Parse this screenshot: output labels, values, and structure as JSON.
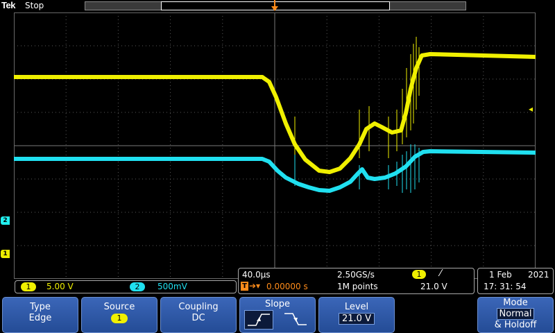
{
  "header": {
    "brand": "Tek",
    "run_state": "Stop"
  },
  "channels": [
    {
      "id": "1",
      "scale": "5.00 V",
      "color": "#f0f000"
    },
    {
      "id": "2",
      "scale": "500mV",
      "color": "#20e0f0"
    }
  ],
  "timebase": {
    "horizontal_scale": "40.0µs",
    "sample_rate": "2.50GS/s",
    "trigger_delay": "0.00000 s",
    "record_length": "1M points",
    "trigger_source": "1",
    "trigger_level": "21.0 V"
  },
  "datetime": {
    "date": "1 Feb",
    "year": "2021",
    "time": "17: 31: 54"
  },
  "menu": {
    "type": {
      "label": "Type",
      "value": "Edge"
    },
    "source": {
      "label": "Source",
      "value": "1"
    },
    "coupling": {
      "label": "Coupling",
      "value": "DC"
    },
    "slope": {
      "label": "Slope"
    },
    "level": {
      "label": "Level",
      "value": "21.0 V"
    },
    "mode": {
      "label": "Mode",
      "value": "Normal",
      "value2": "& Holdoff"
    }
  },
  "markers": {
    "trigger": "T",
    "ch1": "1",
    "ch2": "2"
  },
  "colors": {
    "ch1": "#f0f000",
    "ch2": "#20e0f0",
    "trigger": "#ff8c1a",
    "menu": "#2f5aa8"
  }
}
